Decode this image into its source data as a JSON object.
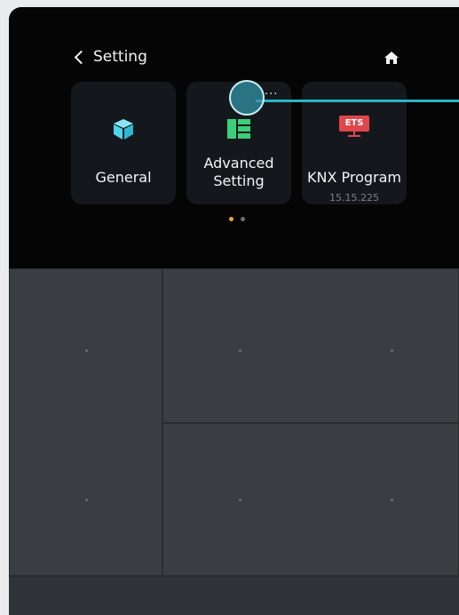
{
  "header": {
    "back_label": "Setting"
  },
  "tiles": [
    {
      "label": "General"
    },
    {
      "label": "Advanced\nSetting"
    },
    {
      "label": "KNX Program",
      "subtitle": "15.15.225",
      "badge": "ETS"
    }
  ],
  "pagination": {
    "total": 2,
    "active": 1
  },
  "colors": {
    "accent": "#f0a23b",
    "callout": "#2bb3c6",
    "general_icon": "#4fd3ea",
    "advanced_icon": "#3ccf7a",
    "ets_badge": "#e0474c"
  },
  "icons": {
    "back": "chevron-left-icon",
    "home": "home-icon",
    "general": "cube-icon",
    "advanced": "layout-grid-icon",
    "knx": "ets-monitor-icon"
  }
}
